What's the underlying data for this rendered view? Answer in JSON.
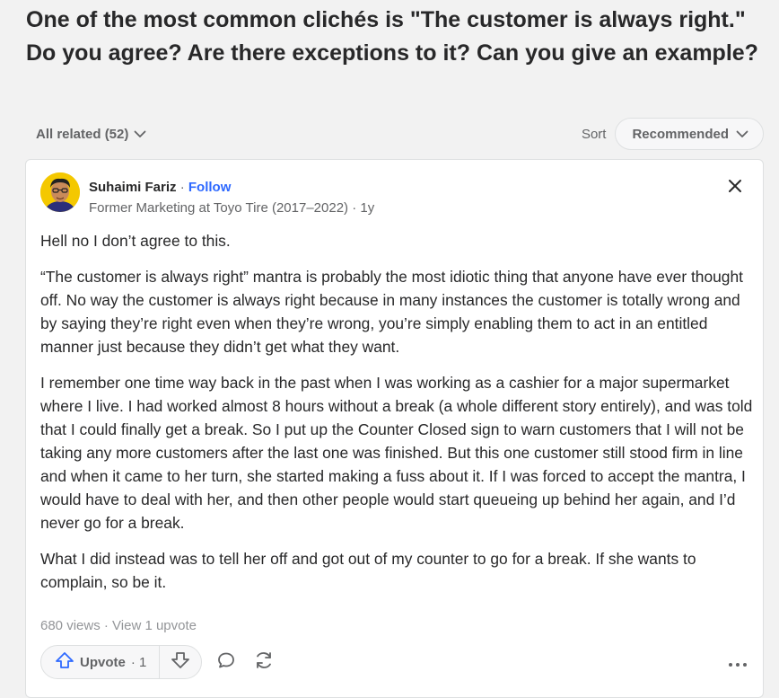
{
  "question": {
    "title": "One of the most common clichés is \"The customer is always right.\" Do you agree? Are there exceptions to it? Can you give an example?"
  },
  "filters": {
    "all_related_label": "All related (52)",
    "sort_label": "Sort",
    "sort_value": "Recommended"
  },
  "answer": {
    "author_name": "Suhaimi Fariz",
    "separator": " · ",
    "follow_label": "Follow",
    "credential": "Former Marketing at Toyo Tire (2017–2022) · 1y",
    "paragraphs": [
      "Hell no I don’t agree to this.",
      "“The customer is always right” mantra is probably the most idiotic thing that anyone have ever thought off. No way the customer is always right because in many instances the customer is totally wrong and by saying they’re right even when they’re wrong, you’re simply enabling them to act in an entitled manner just because they didn’t get what they want.",
      "I remember one time way back in the past when I was working as a cashier for a major supermarket where I live. I had worked almost 8 hours without a break (a whole different story entirely), and was told that I could finally get a break. So I put up the Counter Closed sign to warn customers that I will not be taking any more customers after the last one was finished. But this one customer still stood firm in line and when it came to her turn, she started making a fuss about it. If I was forced to accept the mantra, I would have to deal with her, and then other people would start queueing up behind her again, and I’d never go for a break.",
      "What I did instead was to tell her off and got out of my counter to go for a break. If she wants to complain, so be it."
    ],
    "views": "680 views",
    "stats_separator": " · ",
    "upvote_link": "View 1 upvote",
    "upvote_label": "Upvote",
    "upvote_count": "· 1"
  },
  "colors": {
    "accent": "#2e69ff",
    "text": "#282829",
    "muted": "#636466",
    "background": "#f2f2f2"
  },
  "icons": [
    "chevron-down-icon",
    "close-icon",
    "upvote-arrow-icon",
    "downvote-arrow-icon",
    "comment-icon",
    "share-icon",
    "more-icon"
  ]
}
